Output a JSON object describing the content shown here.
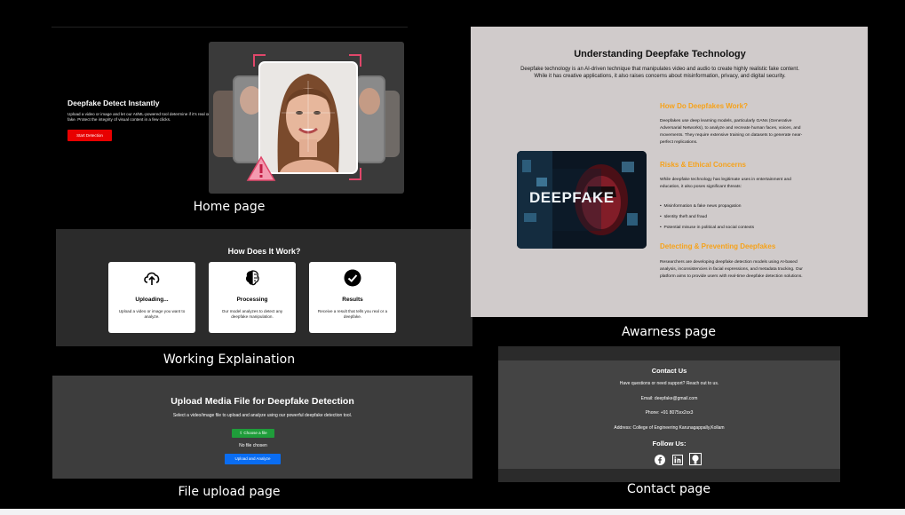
{
  "home": {
    "title": "Deepfake Detect Instantly",
    "description": "Upload a video or image and let our AI/ML-powered tool determine if it's real or fake. Protect the integrity of visual content in a few clicks.",
    "button": "Start Detection",
    "caption": "Home page"
  },
  "working": {
    "title": "How Does It Work?",
    "cards": [
      {
        "title": "Uploading...",
        "desc": "Upload a video or image you want to analyze.",
        "icon": "cloud-upload-icon"
      },
      {
        "title": "Processing",
        "desc": "Our model analyzes to detect any deepfake manipulation.",
        "icon": "brain-icon"
      },
      {
        "title": "Results",
        "desc": "Receive a result that tells you real or a deepfake.",
        "icon": "check-circle-icon"
      }
    ],
    "caption": "Working  Explaination"
  },
  "upload": {
    "title": "Upload Media File for Deepfake Detection",
    "subtitle": "Select a video/image file to upload and analyze using our powerful deepfake detection tool.",
    "choose_label": "Choose a file",
    "no_file": "No file chosen",
    "button": "Upload and Analyze",
    "caption": "File upload page"
  },
  "awareness": {
    "title": "Understanding Deepfake Technology",
    "intro": "Deepfake technology is an AI-driven technique that manipulates video and audio to create highly realistic fake content. While it has creative applications, it also raises concerns about misinformation, privacy, and digital security.",
    "image_text": "DEEPFAKE",
    "sections": [
      {
        "heading": "How Do Deepfakes Work?",
        "text": "Deepfakes use deep learning models, particularly GANs (Generative Adversarial Networks), to analyze and recreate human faces, voices, and movements. They require extensive training on datasets to generate near-perfect replications."
      },
      {
        "heading": "Risks & Ethical Concerns",
        "text": "While deepfake technology has legitimate uses in entertainment and education, it also poses significant threats:",
        "bullets": [
          "Misinformation & fake news propagation",
          "Identity theft and fraud",
          "Potential misuse in political and social contexts"
        ]
      },
      {
        "heading": "Detecting & Preventing Deepfakes",
        "text": "Researchers are developing deepfake detection models using AI-based analysis, inconsistencies in facial expressions, and metadata tracking. Our platform aims to provide users with real-time deepfake detection solutions."
      }
    ],
    "caption": "Awarness page"
  },
  "contact": {
    "title": "Contact Us",
    "subtitle": "Have questions or need support? Reach out to us.",
    "email": "Email: deepfake@gmail.com",
    "phone": "Phone: +91 8075xx2xx3",
    "address": "Address: College of Engineering Karunagappally,Kollam",
    "follow": "Follow Us:",
    "caption": "Contact page"
  }
}
